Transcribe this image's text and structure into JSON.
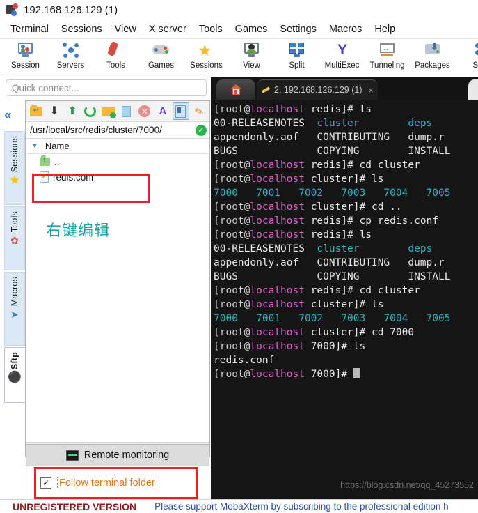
{
  "window": {
    "title": "192.168.126.129 (1)",
    "icon": "mobaxterm-logo-icon"
  },
  "menubar": [
    {
      "label": "Terminal"
    },
    {
      "label": "Sessions"
    },
    {
      "label": "View"
    },
    {
      "label": "X server"
    },
    {
      "label": "Tools"
    },
    {
      "label": "Games"
    },
    {
      "label": "Settings"
    },
    {
      "label": "Macros"
    },
    {
      "label": "Help"
    }
  ],
  "toolbar": [
    {
      "label": "Session",
      "icon": "session-monitor-icon"
    },
    {
      "label": "Servers",
      "icon": "servers-network-icon"
    },
    {
      "label": "Tools",
      "icon": "tools-knife-icon"
    },
    {
      "label": "Games",
      "icon": "games-gamepad-icon"
    },
    {
      "label": "Sessions",
      "icon": "sessions-star-icon"
    },
    {
      "label": "View",
      "icon": "view-monitor-icon"
    },
    {
      "label": "Split",
      "icon": "split-grid-icon"
    },
    {
      "label": "MultiExec",
      "icon": "multiexec-y-icon"
    },
    {
      "label": "Tunneling",
      "icon": "tunneling-icon"
    },
    {
      "label": "Packages",
      "icon": "packages-box-icon"
    },
    {
      "label": "Se",
      "icon": "settings-gear-icon"
    }
  ],
  "quick_connect": {
    "placeholder": "Quick connect...",
    "value": ""
  },
  "vertical_tabs": [
    {
      "label": "Sessions",
      "icon": "star-icon",
      "glyph": "★",
      "color": "#f6bf26",
      "active": false
    },
    {
      "label": "Tools",
      "icon": "swiss-knife-icon",
      "glyph": "▮",
      "color": "#d84b3b",
      "active": false
    },
    {
      "label": "Macros",
      "icon": "paper-plane-icon",
      "glyph": "➤",
      "color": "#3d7ec6",
      "active": false
    },
    {
      "label": "Sftp",
      "icon": "globe-icon",
      "glyph": "●",
      "color": "#f0902a",
      "active": true
    }
  ],
  "collapse_button": {
    "label": "«",
    "name": "collapse-sidebar-icon"
  },
  "sftp": {
    "toolbar_buttons": [
      {
        "icon": "go-up-folder-icon",
        "selected": false
      },
      {
        "icon": "download-icon",
        "selected": false
      },
      {
        "icon": "upload-icon",
        "selected": false
      },
      {
        "icon": "refresh-icon",
        "selected": false
      },
      {
        "icon": "new-folder-icon",
        "selected": false
      },
      {
        "icon": "new-file-icon",
        "selected": false
      },
      {
        "icon": "delete-icon",
        "selected": false
      },
      {
        "icon": "text-mode-icon",
        "selected": false
      },
      {
        "icon": "split-view-icon",
        "selected": true
      },
      {
        "icon": "edit-wand-icon",
        "selected": false
      }
    ],
    "path": "/usr/local/src/redis/cluster/7000/",
    "path_ok_icon": "check-circle-icon",
    "column_header": "Name",
    "sort_caret": "▼",
    "files": [
      {
        "name": "..",
        "icon": "parent-folder-icon",
        "type": "updir"
      },
      {
        "name": "redis.conf",
        "icon": "config-file-icon",
        "type": "file"
      }
    ],
    "hscroll": {
      "left_arrow": "‹",
      "right_arrow": "›"
    }
  },
  "annotations": {
    "chinese_note": "右键编辑",
    "note_color": "#17a8a8",
    "highlight_color": "#f02020"
  },
  "remote_monitoring": {
    "label": "Remote monitoring",
    "icon": "monitor-graph-icon"
  },
  "follow_terminal_folder": {
    "label": "Follow terminal folder",
    "checked": true,
    "check_glyph": "✓"
  },
  "terminal": {
    "tabs": [
      {
        "label": "",
        "icon": "home-icon",
        "name": "home-tab",
        "active": false
      },
      {
        "label": "2. 192.168.126.129 (1)",
        "icon": "ssh-session-icon",
        "name": "session-tab",
        "active": true,
        "close_glyph": "×"
      }
    ],
    "new_tab_glyph": "",
    "watermark": "https://blog.csdn.net/qq_45273552",
    "cursor": "block",
    "lines": [
      [
        {
          "t": "[root@",
          "c": "brk"
        },
        {
          "t": "localhost",
          "c": "user"
        },
        {
          "t": " redis]# ls",
          "c": "white"
        }
      ],
      [
        {
          "t": "00-RELEASENOTES  ",
          "c": "white"
        },
        {
          "t": "cluster",
          "c": "dir"
        },
        {
          "t": "        ",
          "c": "white"
        },
        {
          "t": "deps",
          "c": "dir"
        }
      ],
      [
        {
          "t": "appendonly.aof   CONTRIBUTING   dump.r",
          "c": "white"
        }
      ],
      [
        {
          "t": "BUGS             COPYING        INSTALL",
          "c": "white"
        }
      ],
      [
        {
          "t": "[root@",
          "c": "brk"
        },
        {
          "t": "localhost",
          "c": "user"
        },
        {
          "t": " redis]# cd cluster",
          "c": "white"
        }
      ],
      [
        {
          "t": "[root@",
          "c": "brk"
        },
        {
          "t": "localhost",
          "c": "user"
        },
        {
          "t": " cluster]# ls",
          "c": "white"
        }
      ],
      [
        {
          "t": "7000   7001   7002   7003   7004   7005",
          "c": "dir"
        }
      ],
      [
        {
          "t": "[root@",
          "c": "brk"
        },
        {
          "t": "localhost",
          "c": "user"
        },
        {
          "t": " cluster]# cd ..",
          "c": "white"
        }
      ],
      [
        {
          "t": "[root@",
          "c": "brk"
        },
        {
          "t": "localhost",
          "c": "user"
        },
        {
          "t": " redis]# cp redis.conf",
          "c": "white"
        }
      ],
      [
        {
          "t": "[root@",
          "c": "brk"
        },
        {
          "t": "localhost",
          "c": "user"
        },
        {
          "t": " redis]# ls",
          "c": "white"
        }
      ],
      [
        {
          "t": "00-RELEASENOTES  ",
          "c": "white"
        },
        {
          "t": "cluster",
          "c": "dir"
        },
        {
          "t": "        ",
          "c": "white"
        },
        {
          "t": "deps",
          "c": "dir"
        }
      ],
      [
        {
          "t": "appendonly.aof   CONTRIBUTING   dump.r",
          "c": "white"
        }
      ],
      [
        {
          "t": "BUGS             COPYING        INSTALL",
          "c": "white"
        }
      ],
      [
        {
          "t": "[root@",
          "c": "brk"
        },
        {
          "t": "localhost",
          "c": "user"
        },
        {
          "t": " redis]# cd cluster",
          "c": "white"
        }
      ],
      [
        {
          "t": "[root@",
          "c": "brk"
        },
        {
          "t": "localhost",
          "c": "user"
        },
        {
          "t": " cluster]# ls",
          "c": "white"
        }
      ],
      [
        {
          "t": "7000   7001   7002   7003   7004   7005",
          "c": "dir"
        }
      ],
      [
        {
          "t": "[root@",
          "c": "brk"
        },
        {
          "t": "localhost",
          "c": "user"
        },
        {
          "t": " cluster]# cd 7000",
          "c": "white"
        }
      ],
      [
        {
          "t": "[root@",
          "c": "brk"
        },
        {
          "t": "localhost",
          "c": "user"
        },
        {
          "t": " 7000]# ls",
          "c": "white"
        }
      ],
      [
        {
          "t": "redis.conf",
          "c": "white"
        }
      ],
      [
        {
          "t": "[root@",
          "c": "brk"
        },
        {
          "t": "localhost",
          "c": "user"
        },
        {
          "t": " 7000]# ",
          "c": "white"
        },
        {
          "t": "",
          "c": "cursor"
        }
      ]
    ]
  },
  "statusbar": {
    "unregistered": "UNREGISTERED VERSION",
    "message": "Please support MobaXterm by subscribing to the professional edition h"
  }
}
